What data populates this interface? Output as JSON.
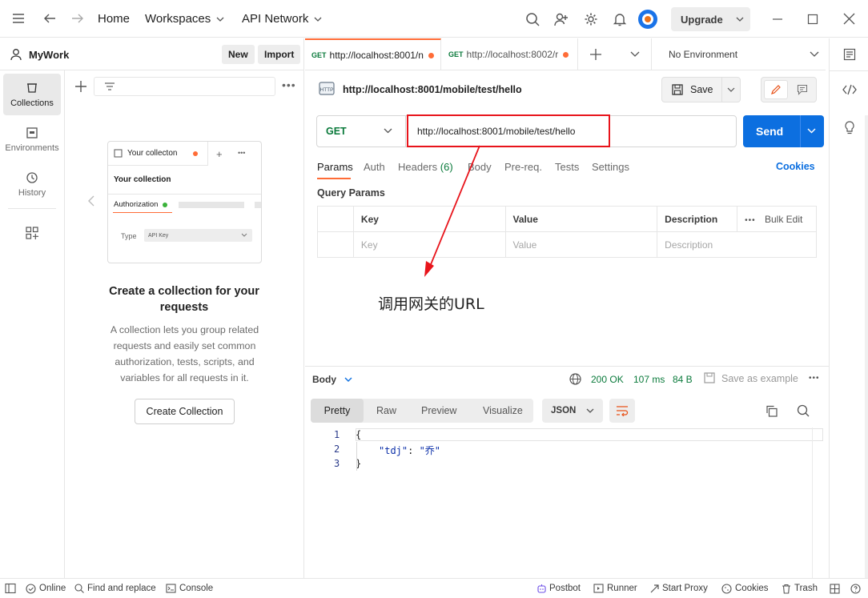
{
  "nav": {
    "home": "Home",
    "workspaces": "Workspaces",
    "api_network": "API Network",
    "upgrade": "Upgrade"
  },
  "workspace": {
    "name": "MyWork",
    "new_label": "New",
    "import_label": "Import"
  },
  "rail": [
    {
      "label": "Collections",
      "icon": "collections-icon"
    },
    {
      "label": "Environments",
      "icon": "environments-icon"
    },
    {
      "label": "History",
      "icon": "history-icon"
    }
  ],
  "sidebar": {
    "illus_tab": "Your collecton",
    "illus_title": "Your collection",
    "illus_auth": "Authorization",
    "illus_type": "Type",
    "illus_type_value": "API Key",
    "empty_title": "Create a collection for your requests",
    "empty_desc": "A collection lets you group related requests and easily set common authorization, tests, scripts, and variables for all requests in it.",
    "create_btn": "Create Collection"
  },
  "tabs": [
    {
      "method": "GET",
      "label": "http://localhost:8001/n"
    },
    {
      "method": "GET",
      "label": "http://localhost:8002/r"
    }
  ],
  "environment": "No Environment",
  "request": {
    "title": "http://localhost:8001/mobile/test/hello",
    "http_badge": "HTTP",
    "save": "Save",
    "method": "GET",
    "url": "http://localhost:8001/mobile/test/hello",
    "send": "Send",
    "subtabs": [
      "Params",
      "Auth",
      "Headers",
      "Body",
      "Pre-req.",
      "Tests",
      "Settings"
    ],
    "headers_count": "(6)",
    "cookies": "Cookies",
    "query_params": "Query Params",
    "cols": {
      "key": "Key",
      "value": "Value",
      "description": "Description",
      "bulk": "Bulk Edit"
    },
    "placeholders": {
      "key": "Key",
      "value": "Value",
      "description": "Description"
    }
  },
  "annotation": {
    "text": "调用网关的URL",
    "color": "#e8141b"
  },
  "response": {
    "body_label": "Body",
    "status": "200 OK",
    "time": "107 ms",
    "size": "84 B",
    "save_example": "Save as example",
    "views": [
      "Pretty",
      "Raw",
      "Preview",
      "Visualize"
    ],
    "format": "JSON",
    "lines": [
      {
        "n": "1",
        "text": "{"
      },
      {
        "n": "2",
        "key": "\"tdj\"",
        "sep": ": ",
        "val": "\"乔\""
      },
      {
        "n": "3",
        "text": "}"
      }
    ]
  },
  "footer": {
    "online": "Online",
    "find": "Find and replace",
    "console": "Console",
    "postbot": "Postbot",
    "runner": "Runner",
    "proxy": "Start Proxy",
    "cookies": "Cookies",
    "trash": "Trash"
  },
  "colors": {
    "accent": "#ff6c37",
    "send": "#0c6fe0",
    "link": "#0c6fe0",
    "ok": "#0a7a3b"
  }
}
